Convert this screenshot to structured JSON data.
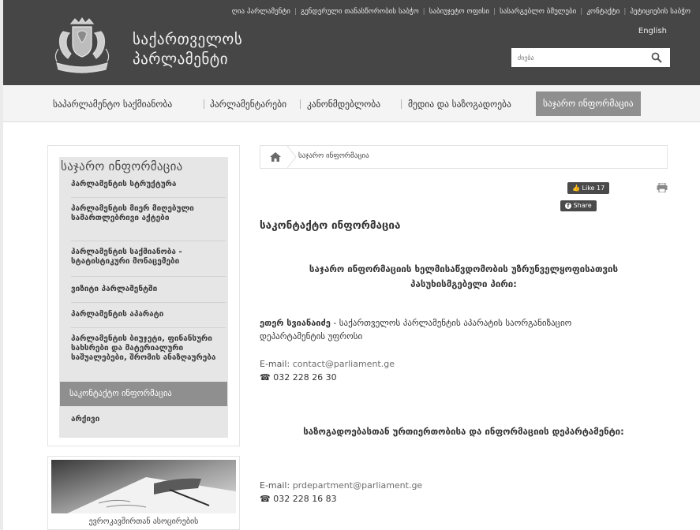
{
  "header": {
    "toplinks": [
      "ღია პარლამენტი",
      "გენდერული თანასწორობის საბჭო",
      "საბიუჯეტო ოფისი",
      "სასარგებლო ბმულები",
      "კონტაქტი",
      "პეტიციების საბჭო"
    ],
    "title_line1": "საქართველოს",
    "title_line2": "პარლამენტი",
    "lang": "English",
    "search_placeholder": "ძიება"
  },
  "nav": {
    "items": [
      "საპარლამენტო საქმიანობა",
      "პარლამენტარები",
      "კანონმდებლობა",
      "მედია და საზოგადოება",
      "საჯარო ინფორმაცია"
    ],
    "active_index": 4
  },
  "sidebar": {
    "title": "საჯარო ინფორმაცია",
    "items": [
      "პარლამენტის სტრუქტურა",
      "პარლამენტის მიერ მიღებული სამართლებრივი აქტები",
      "პარლამენტის საქმიანობა - სტატისტიკური მონაცემები",
      "ვიზიტი პარლამენტში",
      "პარლამენტის აპარატი",
      "პარლამენტის ბიუჯეტი, ფინანსური სახსრები და მატერიალური საშუალებები, შრომის ანაზღაურება",
      "საკონტაქტო ინფორმაცია",
      "არქივი"
    ],
    "active_index": 6
  },
  "banner": {
    "caption": "ევროკავშირთან ასოცირების"
  },
  "breadcrumb": {
    "current": "საჯარო ინფორმაცია"
  },
  "social": {
    "like_label": "Like",
    "like_count": "17",
    "share_label": "Share"
  },
  "article": {
    "title": "საკონტაქტო ინფორმაცია",
    "heading1_line1": "საჯარო ინფორმაციის ხელმისაწვდომობის უზრუნველყოფისათვის",
    "heading1_line2": "პასუხისმგებელი პირი:",
    "person_name": "ეთერ სვიანაიძე",
    "person_role_line1": " - საქართველოს პარლამენტის აპარატის საორგანიზაციო",
    "person_role_line2": "დეპარტამენტის უფროსი",
    "email_label": "E-mail:",
    "email1": "contact@parliament.ge",
    "phone_icon": "☎",
    "phone1": "032 228 26 30",
    "heading2": "საზოგადოებასთან ურთიერთობისა და ინფორმაციის დეპარტამენტი:",
    "email2": "prdepartment@parliament.ge",
    "phone2": "032 228 16 83"
  }
}
